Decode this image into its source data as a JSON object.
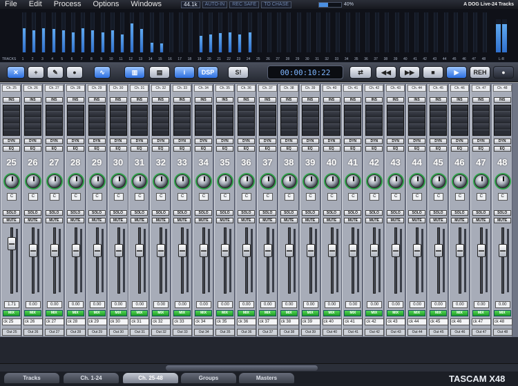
{
  "menu": {
    "items": [
      "File",
      "Edit",
      "Process",
      "Options",
      "Windows"
    ],
    "status": {
      "sample_rate": "44.1k",
      "auto_in": "AUTO-IN",
      "rec": "REC SAFE",
      "chase": "TO CHASE",
      "progress_fraction": 0.4,
      "progress_label": "40%",
      "device": "A DOG Live-24 Tracks"
    }
  },
  "meterbridge": {
    "tracks_label": "TRACKS",
    "lr_label": "L-R",
    "numbers": [
      "1",
      "2",
      "3",
      "4",
      "5",
      "6",
      "7",
      "8",
      "9",
      "10",
      "11",
      "12",
      "13",
      "14",
      "15",
      "16",
      "17",
      "18",
      "19",
      "20",
      "21",
      "22",
      "23",
      "24",
      "25",
      "26",
      "27",
      "28",
      "29",
      "30",
      "31",
      "32",
      "33",
      "34",
      "35",
      "36",
      "37",
      "38",
      "39",
      "40",
      "41",
      "42",
      "43",
      "44",
      "45",
      "46",
      "47",
      "48"
    ],
    "levels": [
      0.6,
      0.55,
      0.6,
      0.58,
      0.55,
      0.5,
      0.6,
      0.55,
      0.5,
      0.55,
      0.45,
      0.72,
      0.58,
      0.25,
      0.22,
      0,
      0,
      0,
      0.42,
      0.45,
      0.48,
      0.5,
      0.45,
      0.5,
      0,
      0,
      0,
      0,
      0,
      0,
      0,
      0,
      0,
      0,
      0,
      0,
      0,
      0,
      0,
      0,
      0,
      0,
      0,
      0,
      0,
      0,
      0,
      0
    ],
    "lr_levels": [
      0.85,
      0.85
    ]
  },
  "toolbar": {
    "timecode": "00:00:10:22",
    "btn_dsp": "DSP",
    "btn_s": "S!",
    "btn_reh": "REH",
    "btn_lr": "L-R",
    "btn_i": "i"
  },
  "mixer": {
    "ins_label": "INS",
    "dyn_label": "DYN",
    "eq_label": "EQ",
    "solo_label": "SOLO",
    "mute_label": "MUTE",
    "mix_label": "MIX",
    "channels": [
      {
        "label": "Ch. 25",
        "num": "25",
        "pan": "C",
        "fader": "1.71",
        "track": "ck 25",
        "out": "Out 25"
      },
      {
        "label": "Ch. 26",
        "num": "26",
        "pan": "C",
        "fader": "0.00",
        "track": "ck 26",
        "out": "Out 26"
      },
      {
        "label": "Ch. 27",
        "num": "27",
        "pan": "C",
        "fader": "0.00",
        "track": "ck 27",
        "out": "Out 27"
      },
      {
        "label": "Ch. 28",
        "num": "28",
        "pan": "C",
        "fader": "0.00",
        "track": "ck 28",
        "out": "Out 28"
      },
      {
        "label": "Ch. 29",
        "num": "29",
        "pan": "C",
        "fader": "0.00",
        "track": "ck 29",
        "out": "Out 29"
      },
      {
        "label": "Ch. 30",
        "num": "30",
        "pan": "C",
        "fader": "0.00",
        "track": "ck 30",
        "out": "Out 30"
      },
      {
        "label": "Ch. 31",
        "num": "31",
        "pan": "C",
        "fader": "0.00",
        "track": "ck 31",
        "out": "Out 31"
      },
      {
        "label": "Ch. 32",
        "num": "32",
        "pan": "C",
        "fader": "0.00",
        "track": "ck 32",
        "out": "Out 32"
      },
      {
        "label": "Ch. 33",
        "num": "33",
        "pan": "C",
        "fader": "0.00",
        "track": "ck 33",
        "out": "Out 33"
      },
      {
        "label": "Ch. 34",
        "num": "34",
        "pan": "C",
        "fader": "0.00",
        "track": "ck 34",
        "out": "Out 34"
      },
      {
        "label": "Ch. 35",
        "num": "35",
        "pan": "C",
        "fader": "0.00",
        "track": "ck 35",
        "out": "Out 35"
      },
      {
        "label": "Ch. 36",
        "num": "36",
        "pan": "C",
        "fader": "0.00",
        "track": "ck 36",
        "out": "Out 36"
      },
      {
        "label": "Ch. 37",
        "num": "37",
        "pan": "C",
        "fader": "0.00",
        "track": "ck 37",
        "out": "Out 37"
      },
      {
        "label": "Ch. 38",
        "num": "38",
        "pan": "C",
        "fader": "0.00",
        "track": "ck 38",
        "out": "Out 38"
      },
      {
        "label": "Ch. 39",
        "num": "39",
        "pan": "C",
        "fader": "0.00",
        "track": "ck 39",
        "out": "Out 39"
      },
      {
        "label": "Ch. 40",
        "num": "40",
        "pan": "C",
        "fader": "0.00",
        "track": "ck 40",
        "out": "Out 40"
      },
      {
        "label": "Ch. 41",
        "num": "41",
        "pan": "C",
        "fader": "0.00",
        "track": "ck 41",
        "out": "Out 41"
      },
      {
        "label": "Ch. 42",
        "num": "42",
        "pan": "C",
        "fader": "0.00",
        "track": "ck 42",
        "out": "Out 42"
      },
      {
        "label": "Ch. 43",
        "num": "43",
        "pan": "C",
        "fader": "0.00",
        "track": "ck 43",
        "out": "Out 43"
      },
      {
        "label": "Ch. 44",
        "num": "44",
        "pan": "C",
        "fader": "0.00",
        "track": "ck 44",
        "out": "Out 44"
      },
      {
        "label": "Ch. 45",
        "num": "45",
        "pan": "C",
        "fader": "0.00",
        "track": "ck 45",
        "out": "Out 45"
      },
      {
        "label": "Ch. 46",
        "num": "46",
        "pan": "C",
        "fader": "0.00",
        "track": "ck 46",
        "out": "Out 46"
      },
      {
        "label": "Ch. 47",
        "num": "47",
        "pan": "C",
        "fader": "0.00",
        "track": "ck 47",
        "out": "Out 47"
      },
      {
        "label": "Ch. 48",
        "num": "48",
        "pan": "C",
        "fader": "0.00",
        "track": "ck 48",
        "out": "Out 48"
      }
    ]
  },
  "tabs": [
    "Tracks",
    "Ch. 1-24",
    "Ch. 25-48",
    "Groups",
    "Masters"
  ],
  "active_tab": 2,
  "brand": "TASCAM X48",
  "colors": {
    "accent": "#2c6fe0",
    "mix_green": "#1a9a22",
    "meter_blue": "#4b8fe0"
  }
}
